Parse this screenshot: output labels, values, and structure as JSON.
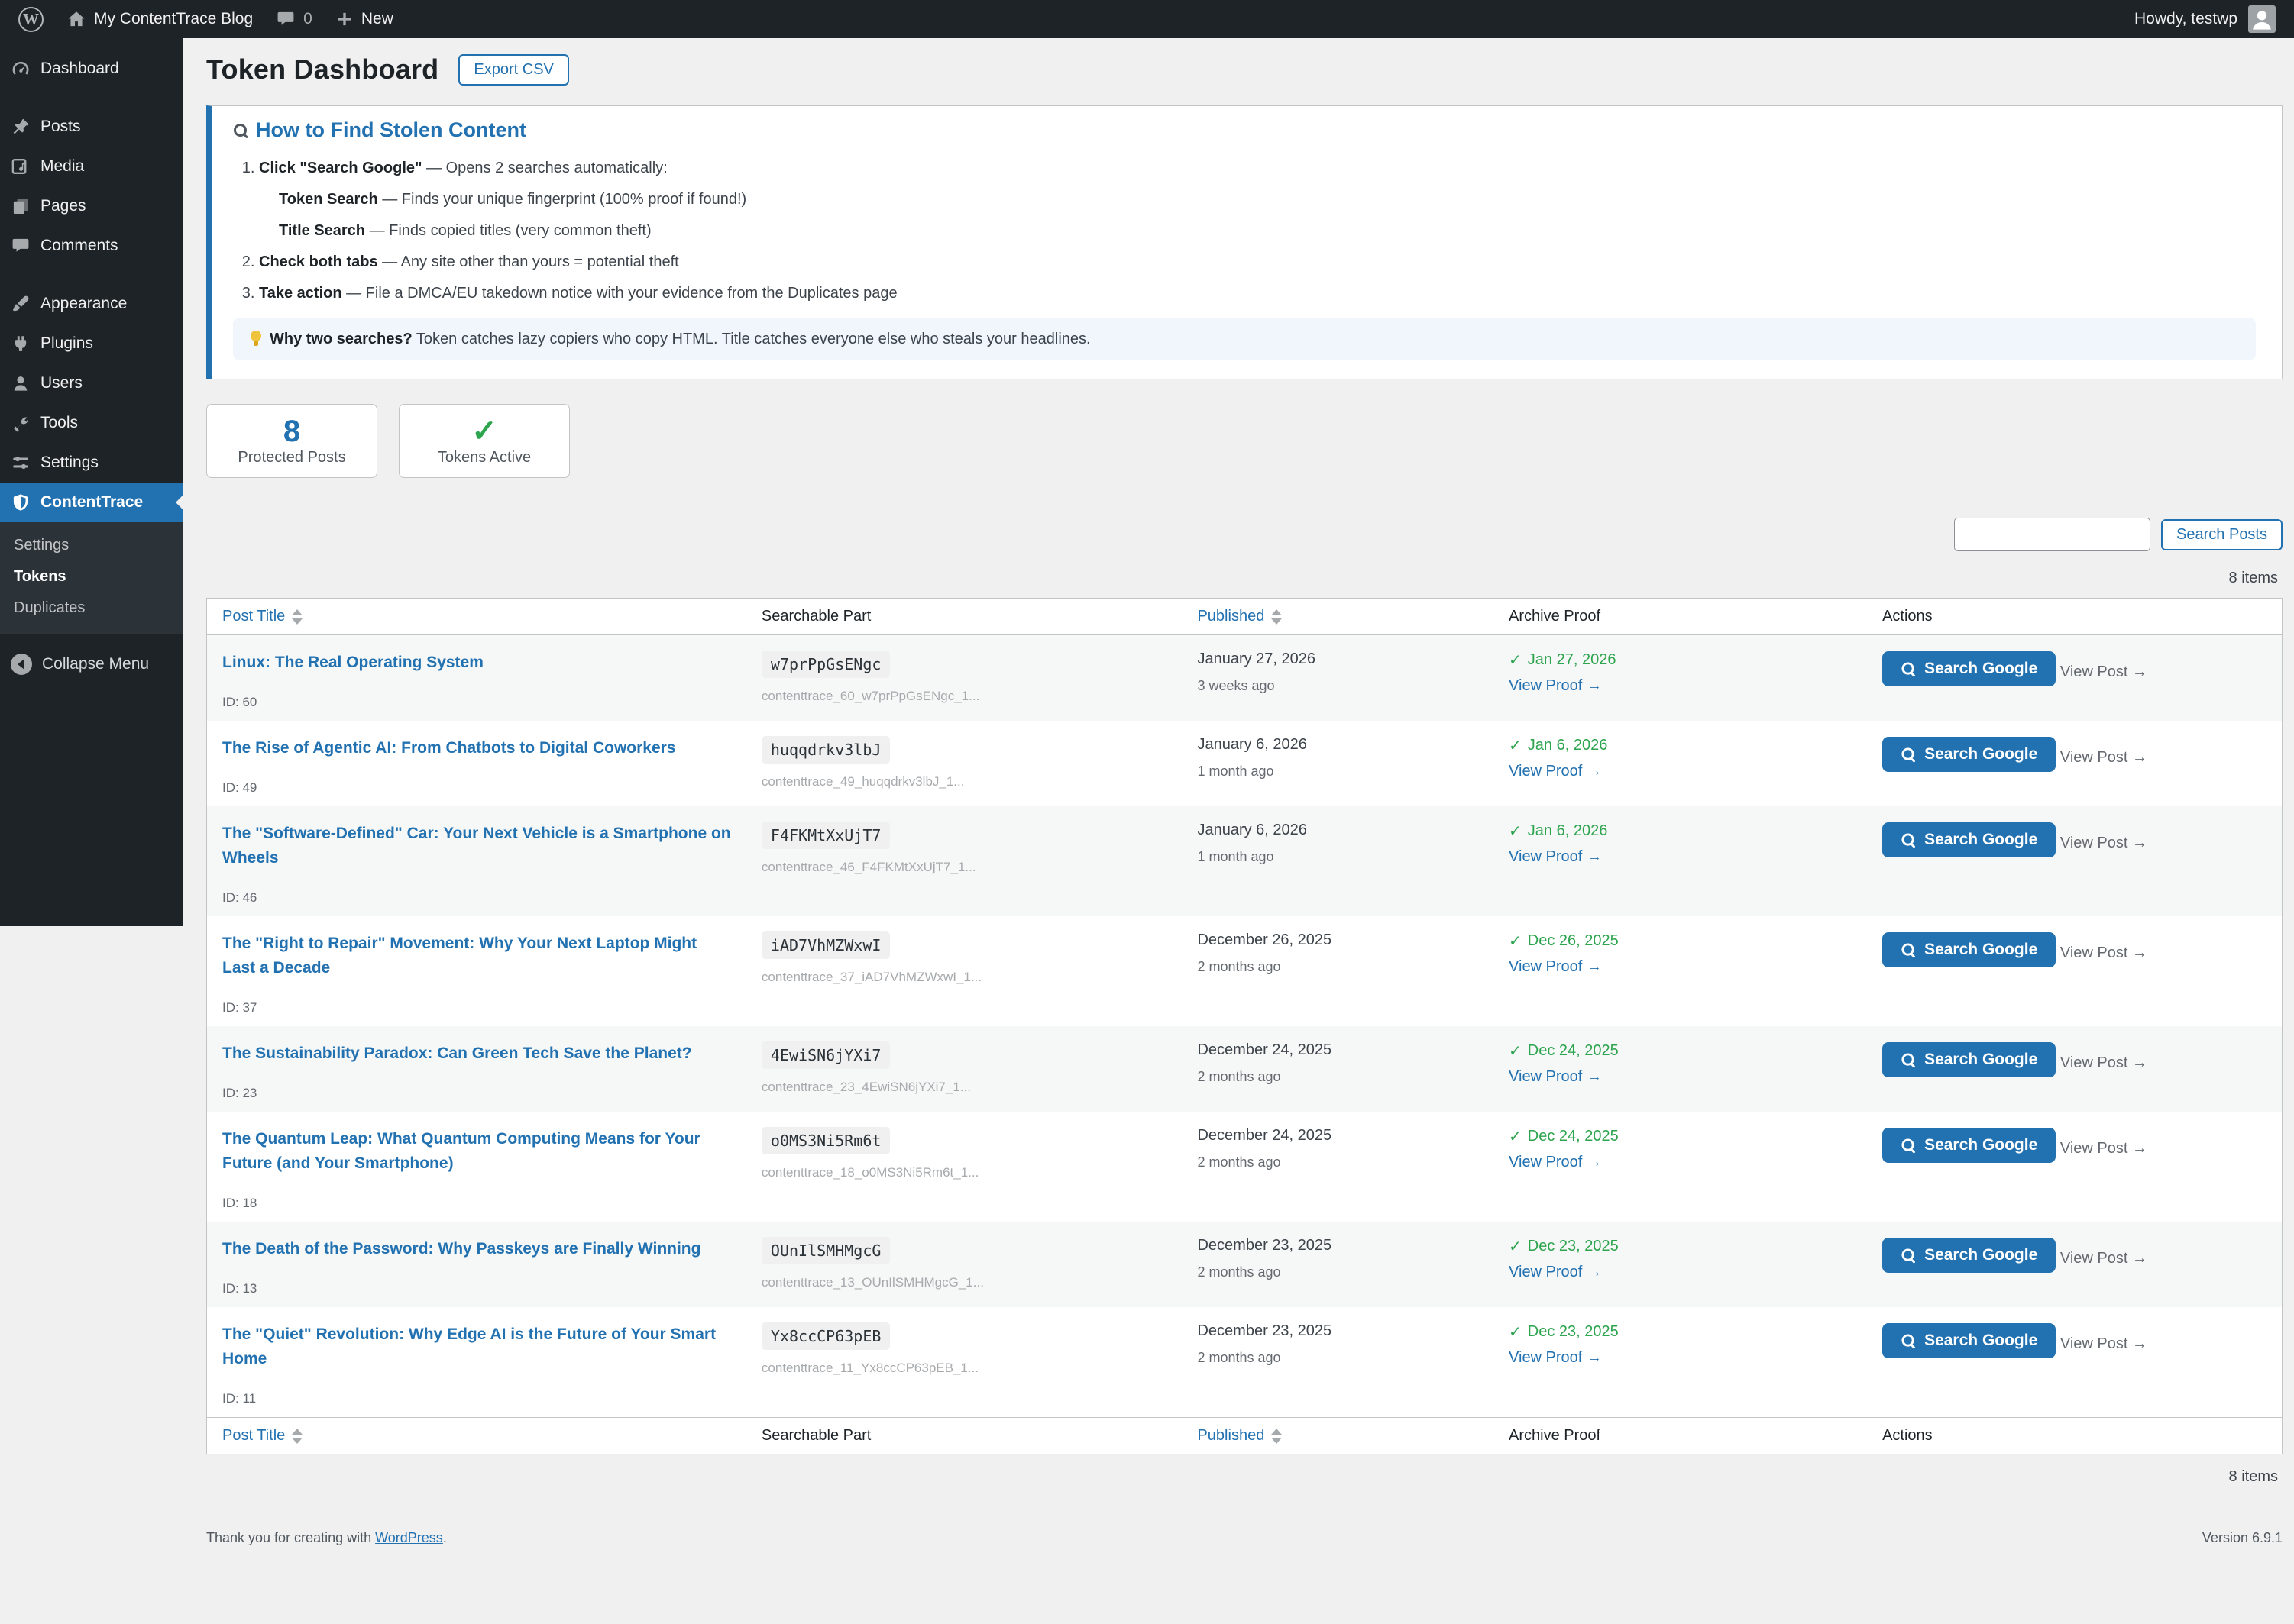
{
  "colors": {
    "accent": "#2271b1",
    "success_green": "#2da44e",
    "admin_dark": "#1d2327",
    "page_bg": "#f0f0f1",
    "tip_bg": "#f0f6fc"
  },
  "admin_bar": {
    "wp_logo_letter": "W",
    "site_name": "My ContentTrace Blog",
    "comments_count": "0",
    "new_label": "New",
    "howdy": "Howdy, testwp"
  },
  "sidebar": {
    "items": [
      {
        "label": "Dashboard"
      },
      {
        "label": "Posts"
      },
      {
        "label": "Media"
      },
      {
        "label": "Pages"
      },
      {
        "label": "Comments"
      },
      {
        "label": "Appearance"
      },
      {
        "label": "Plugins"
      },
      {
        "label": "Users"
      },
      {
        "label": "Tools"
      },
      {
        "label": "Settings"
      },
      {
        "label": "ContentTrace"
      }
    ],
    "submenu": [
      {
        "label": "Settings"
      },
      {
        "label": "Tokens"
      },
      {
        "label": "Duplicates"
      }
    ],
    "collapse_label": "Collapse Menu"
  },
  "page": {
    "title": "Token Dashboard",
    "export_button": "Export CSV"
  },
  "howto": {
    "title": "How to Find Stolen Content",
    "steps": [
      {
        "bold": "Click \"Search Google\"",
        "text": " — Opens 2 searches automatically:"
      },
      {
        "bold": "Check both tabs",
        "text": " — Any site other than yours = potential theft"
      },
      {
        "bold": "Take action",
        "text": " — File a DMCA/EU takedown notice with your evidence from the Duplicates page"
      }
    ],
    "substeps": [
      {
        "bold": "Token Search",
        "text": " — Finds your unique fingerprint (100% proof if found!)"
      },
      {
        "bold": "Title Search",
        "text": " — Finds copied titles (very common theft)"
      }
    ],
    "tip_bold": "Why two searches?",
    "tip_text": " Token catches lazy copiers who copy HTML. Title catches everyone else who steals your headlines."
  },
  "stats": [
    {
      "value": "8",
      "label": "Protected Posts"
    },
    {
      "value": "✓",
      "label": "Tokens Active"
    }
  ],
  "search": {
    "button_label": "Search Posts",
    "input_value": ""
  },
  "items_count": "8 items",
  "table": {
    "headers": {
      "post_title": "Post Title",
      "searchable": "Searchable Part",
      "published": "Published",
      "archive": "Archive Proof",
      "actions": "Actions"
    },
    "check": "✓",
    "actions": {
      "search_google": "Search Google",
      "view_post": "View Post →",
      "view_proof": "View Proof →"
    },
    "rows": [
      {
        "title": "Linux: The Real Operating System",
        "id": "ID: 60",
        "token": "w7prPpGsENgc",
        "token_full": "contenttrace_60_w7prPpGsENgc_1...",
        "pub_date": "January 27, 2026",
        "pub_rel": "3 weeks ago",
        "archive_date": "Jan 27, 2026"
      },
      {
        "title": "The Rise of Agentic AI: From Chatbots to Digital Coworkers",
        "id": "ID: 49",
        "token": "huqqdrkv3lbJ",
        "token_full": "contenttrace_49_huqqdrkv3lbJ_1...",
        "pub_date": "January 6, 2026",
        "pub_rel": "1 month ago",
        "archive_date": "Jan 6, 2026"
      },
      {
        "title": "The \"Software-Defined\" Car: Your Next Vehicle is a Smartphone on Wheels",
        "id": "ID: 46",
        "token": "F4FKMtXxUjT7",
        "token_full": "contenttrace_46_F4FKMtXxUjT7_1...",
        "pub_date": "January 6, 2026",
        "pub_rel": "1 month ago",
        "archive_date": "Jan 6, 2026"
      },
      {
        "title": "The \"Right to Repair\" Movement: Why Your Next Laptop Might Last a Decade",
        "id": "ID: 37",
        "token": "iAD7VhMZWxwI",
        "token_full": "contenttrace_37_iAD7VhMZWxwI_1...",
        "pub_date": "December 26, 2025",
        "pub_rel": "2 months ago",
        "archive_date": "Dec 26, 2025"
      },
      {
        "title": "The Sustainability Paradox: Can Green Tech Save the Planet?",
        "id": "ID: 23",
        "token": "4EwiSN6jYXi7",
        "token_full": "contenttrace_23_4EwiSN6jYXi7_1...",
        "pub_date": "December 24, 2025",
        "pub_rel": "2 months ago",
        "archive_date": "Dec 24, 2025"
      },
      {
        "title": "The Quantum Leap: What Quantum Computing Means for Your Future (and Your Smartphone)",
        "id": "ID: 18",
        "token": "o0MS3Ni5Rm6t",
        "token_full": "contenttrace_18_o0MS3Ni5Rm6t_1...",
        "pub_date": "December 24, 2025",
        "pub_rel": "2 months ago",
        "archive_date": "Dec 24, 2025"
      },
      {
        "title": "The Death of the Password: Why Passkeys are Finally Winning",
        "id": "ID: 13",
        "token": "OUnIlSMHMgcG",
        "token_full": "contenttrace_13_OUnIlSMHMgcG_1...",
        "pub_date": "December 23, 2025",
        "pub_rel": "2 months ago",
        "archive_date": "Dec 23, 2025"
      },
      {
        "title": "The \"Quiet\" Revolution: Why Edge AI is the Future of Your Smart Home",
        "id": "ID: 11",
        "token": "Yx8ccCP63pEB",
        "token_full": "contenttrace_11_Yx8ccCP63pEB_1...",
        "pub_date": "December 23, 2025",
        "pub_rel": "2 months ago",
        "archive_date": "Dec 23, 2025"
      }
    ]
  },
  "footer": {
    "thanks_prefix": "Thank you for creating with ",
    "wordpress_link": "WordPress",
    "thanks_suffix": ".",
    "version": "Version 6.9.1"
  }
}
